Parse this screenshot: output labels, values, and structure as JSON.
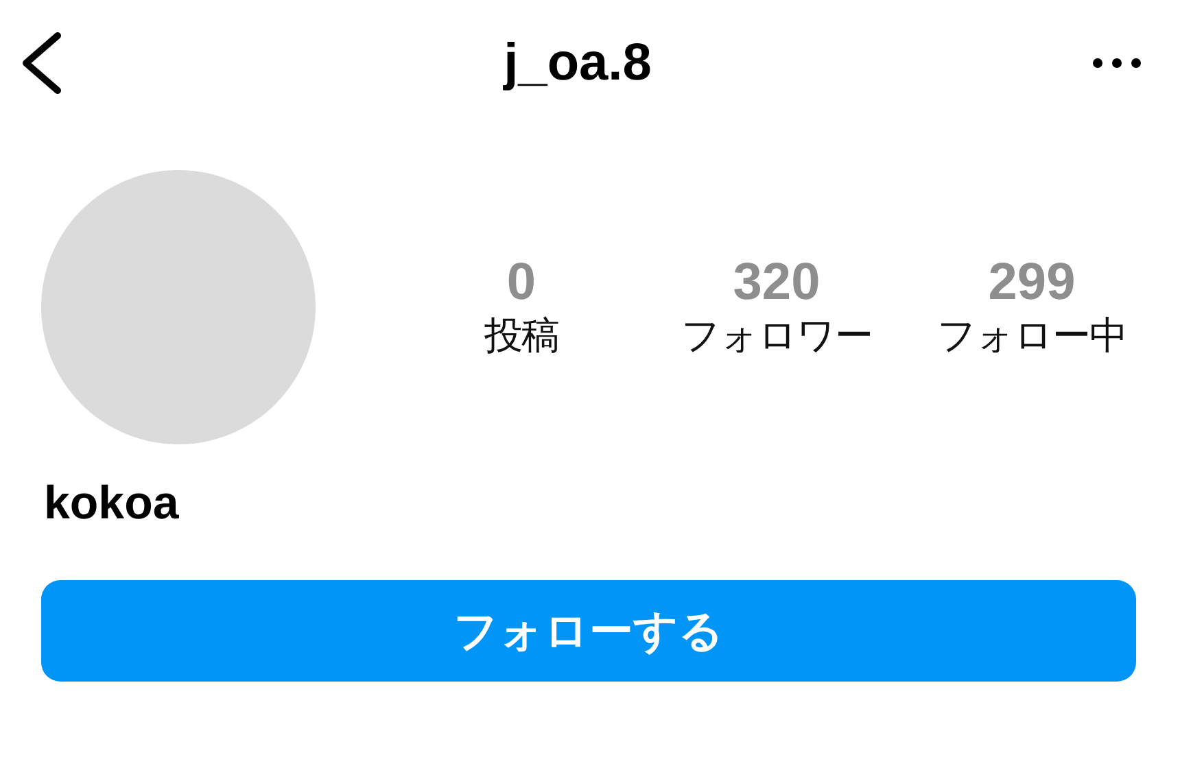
{
  "header": {
    "title": "j_oa.8"
  },
  "profile": {
    "display_name": "kokoa"
  },
  "stats": [
    {
      "count": "0",
      "label": "投稿"
    },
    {
      "count": "320",
      "label": "フォロワー"
    },
    {
      "count": "299",
      "label": "フォロー中"
    }
  ],
  "follow_button": {
    "label": "フォローする"
  }
}
